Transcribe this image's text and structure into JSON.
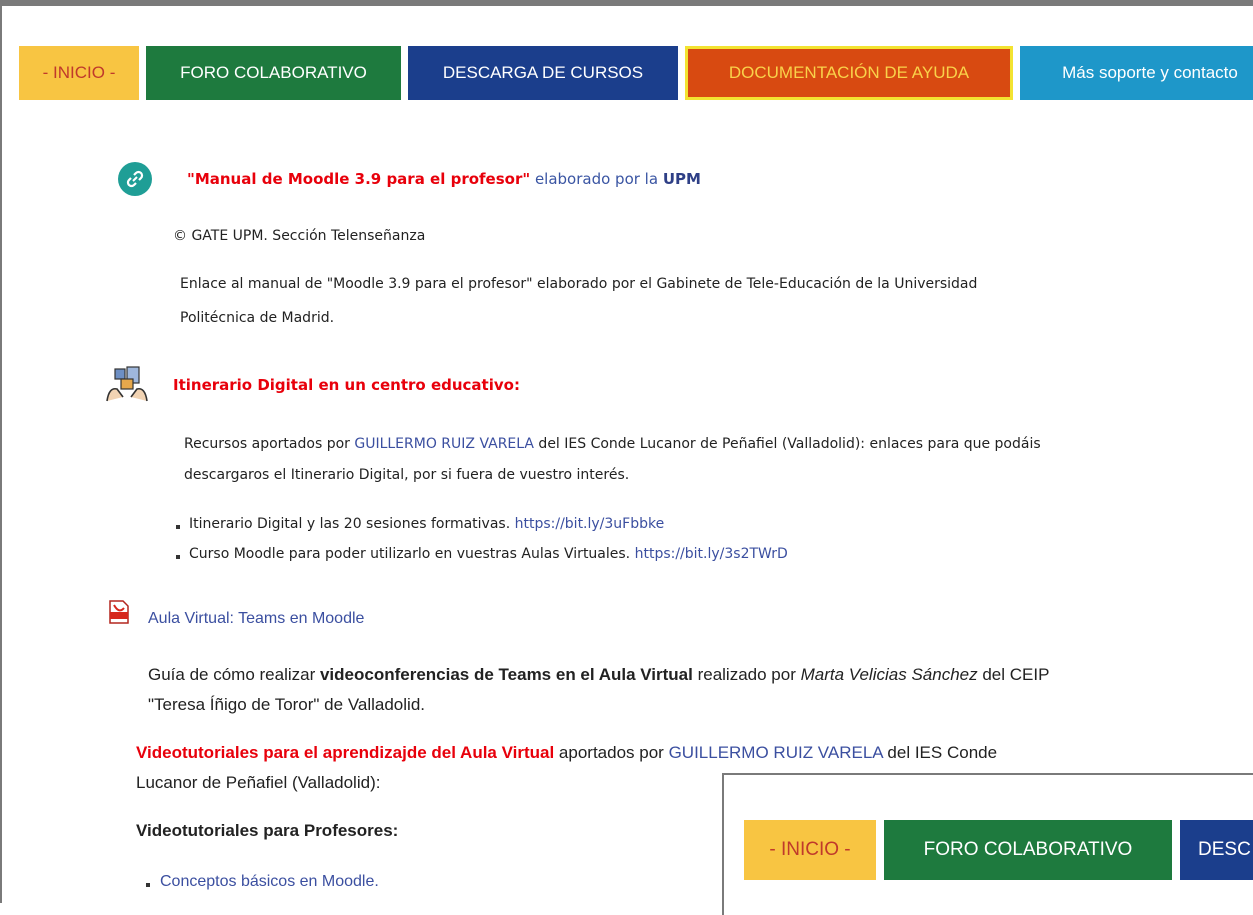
{
  "nav": {
    "inicio": "- INICIO -",
    "foro": "FORO COLABORATIVO",
    "descarga": "DESCARGA DE CURSOS",
    "documentacion": "DOCUMENTACIÓN DE AYUDA",
    "soporte": "Más soporte y contacto"
  },
  "section1": {
    "title_link": "\"Manual de Moodle 3.9 para el profesor\"",
    "title_mid": " elaborado por la ",
    "title_org": "UPM",
    "copyright": "© GATE UPM. Sección Telenseñanza",
    "desc_line1": "Enlace al manual de \"Moodle 3.9 para el profesor\" elaborado por el Gabinete de Tele-Educación de la Universidad",
    "desc_line2": "Politécnica de Madrid."
  },
  "section2": {
    "title": "Itinerario Digital en un centro educativo:",
    "line1_a": "Recursos aportados por ",
    "line1_link": "GUILLERMO RUIZ VARELA",
    "line1_b": " del IES Conde Lucanor de Peñafiel (Valladolid): enlaces para que podáis",
    "line2": "descargaros el Itinerario Digital, por si fuera de vuestro interés.",
    "items": [
      {
        "text": "Itinerario Digital y las 20 sesiones formativas. ",
        "link": "https://bit.ly/3uFbbke"
      },
      {
        "text": "Curso Moodle para poder utilizarlo en vuestras Aulas Virtuales. ",
        "link": "https://bit.ly/3s2TWrD"
      }
    ]
  },
  "section3": {
    "title_link": "Aula Virtual: Teams en Moodle",
    "l1_a": "Guía de cómo realizar ",
    "l1_bold": "videoconferencias de Teams en el Aula Virtual",
    "l1_b": " realizado por ",
    "l1_italic": "Marta Velicias Sánchez",
    "l1_c": " del CEIP",
    "l2": "\"Teresa Íñigo de Toror\" de Valladolid.",
    "video_red": "Videotutoriales para el aprendizajde del Aula Virtual",
    "video_a": " aportados por ",
    "video_link": "GUILLERMO RUIZ VARELA",
    "video_b": " del IES Conde",
    "video_l2": "Lucanor de Peñafiel (Valladolid):",
    "prof_heading": "Videotutoriales para Profesores:",
    "prof_item": "Conceptos básicos en Moodle."
  },
  "overlay": {
    "inicio": "- INICIO -",
    "foro": "FORO COLABORATIVO",
    "desc": "DESC"
  },
  "colors": {
    "inicio": "#f8c542",
    "foro": "#1e7a3e",
    "descarga": "#1b3e8c",
    "documentacion": "#d84a11",
    "soporte": "#1e97c9",
    "red_text": "#e8000b"
  }
}
